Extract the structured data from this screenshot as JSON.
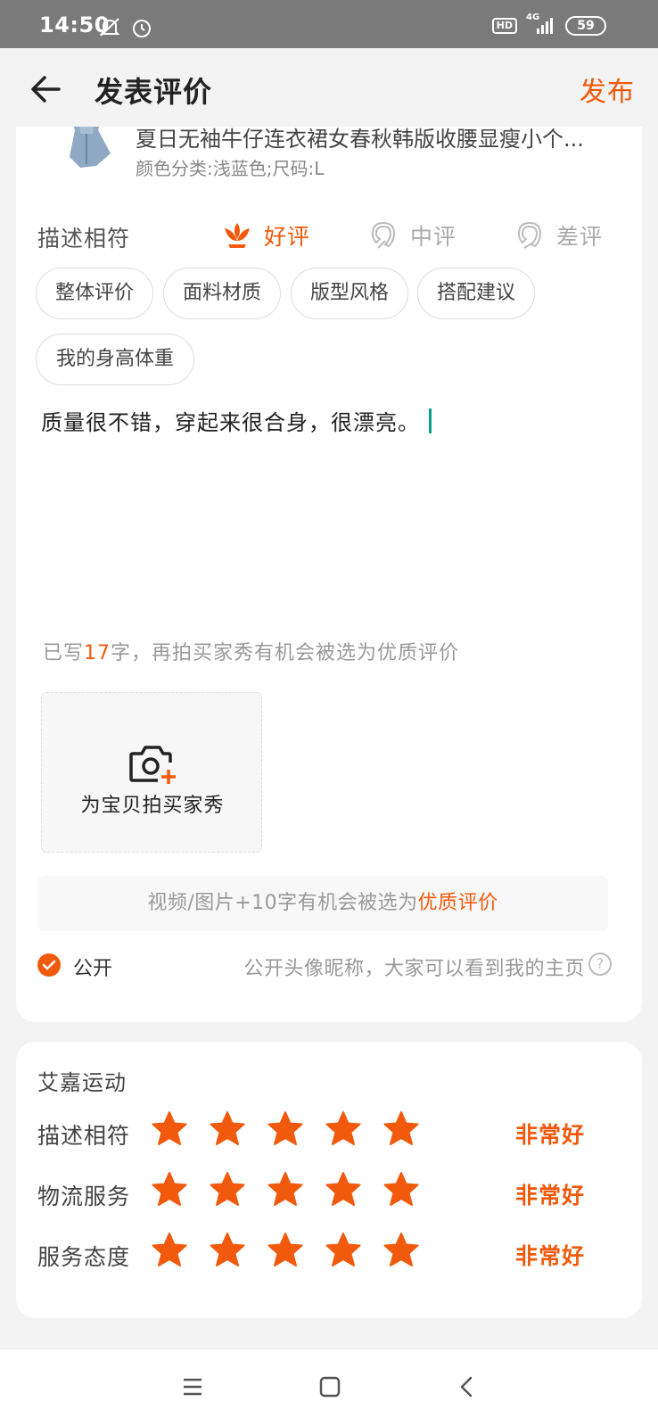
{
  "status_bar": {
    "time": "14:50",
    "hd": "HD",
    "network": "4G",
    "battery": "59",
    "icons": [
      "mute-icon",
      "alarm-icon",
      "signal-icon"
    ]
  },
  "header": {
    "title": "发表评价",
    "publish_label": "发布"
  },
  "product": {
    "name": "夏日无袖牛仔连衣裙女春秋韩版收腰显瘦小个...",
    "spec": "颜色分类:浅蓝色;尺码:L"
  },
  "rating": {
    "label": "描述相符",
    "options": [
      {
        "label": "好评",
        "selected": true
      },
      {
        "label": "中评",
        "selected": false
      },
      {
        "label": "差评",
        "selected": false
      }
    ]
  },
  "tags": [
    "整体评价",
    "面料材质",
    "版型风格",
    "搭配建议",
    "我的身高体重"
  ],
  "review": {
    "text": "质量很不错，穿起来很合身，很漂亮。",
    "count_prefix": "已写",
    "count": "17",
    "count_suffix": "字，再拍买家秀有机会被选为优质评价"
  },
  "upload": {
    "label": "为宝贝拍买家秀"
  },
  "tip": {
    "text": "视频/图片+10字有机会被选为",
    "highlight": "优质评价"
  },
  "public": {
    "label": "公开",
    "checked": true,
    "note": "公开头像昵称，大家可以看到我的主页",
    "help": "?"
  },
  "shop": {
    "name": "艾嘉运动",
    "scores": [
      {
        "label": "描述相符",
        "stars": 5,
        "text": "非常好"
      },
      {
        "label": "物流服务",
        "stars": 5,
        "text": "非常好"
      },
      {
        "label": "服务态度",
        "stars": 5,
        "text": "非常好"
      }
    ]
  },
  "colors": {
    "accent": "#f15a0c",
    "muted": "#aaaaaa",
    "caret": "#0a9c8a"
  }
}
